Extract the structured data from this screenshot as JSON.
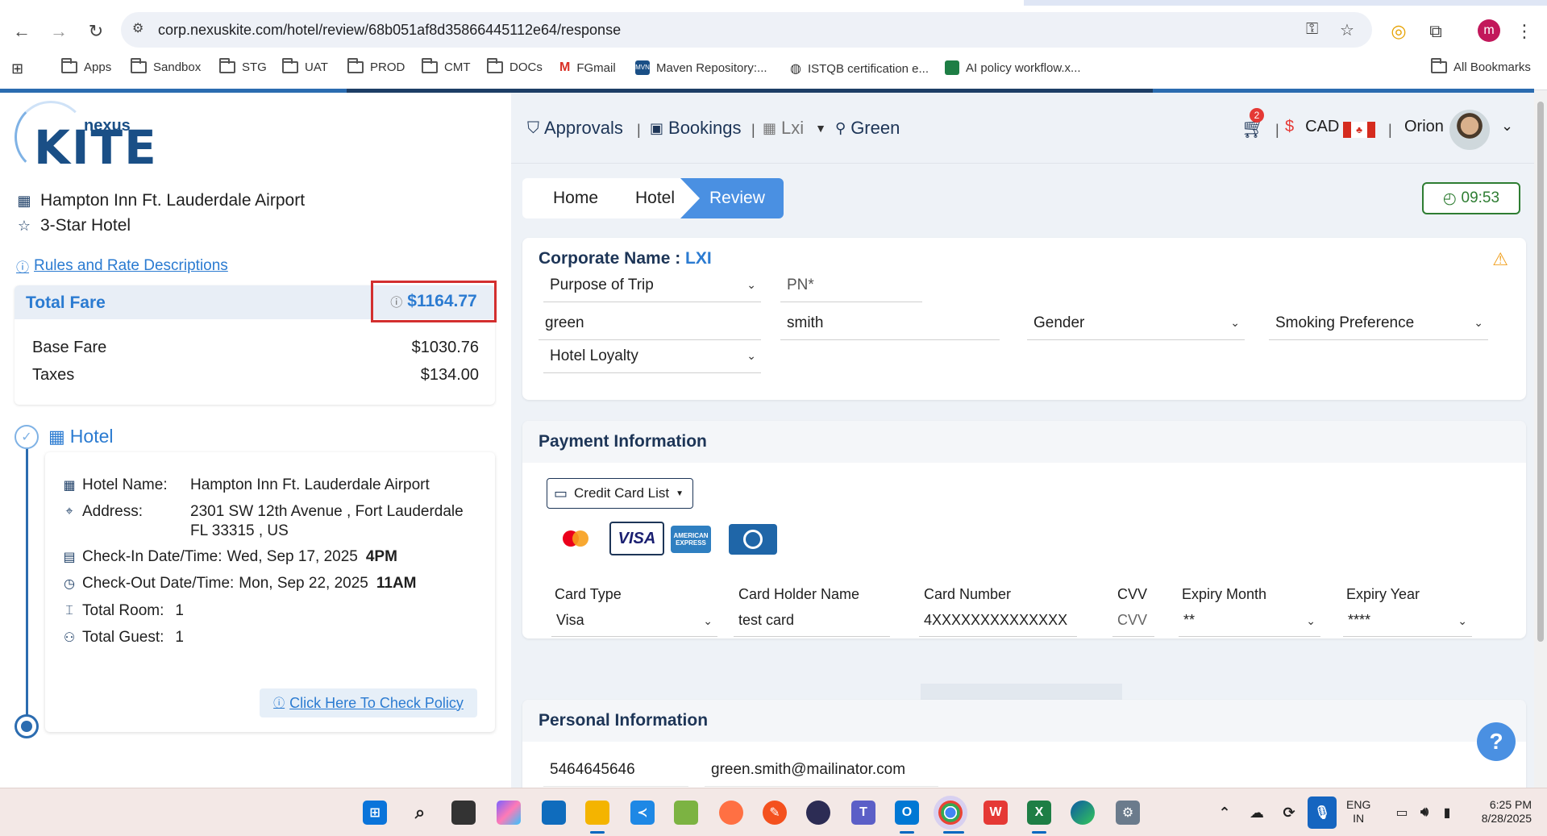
{
  "browser": {
    "url": "corp.nexuskite.com/hotel/review/68b051af8d35866445112e64/response",
    "profile_initial": "m",
    "bookmarks": [
      {
        "label": "Apps"
      },
      {
        "label": "Sandbox"
      },
      {
        "label": "STG"
      },
      {
        "label": "UAT"
      },
      {
        "label": "PROD"
      },
      {
        "label": "CMT"
      },
      {
        "label": "DOCs"
      },
      {
        "label": "FGmail"
      },
      {
        "label": "Maven Repository:..."
      },
      {
        "label": "ISTQB certification e..."
      },
      {
        "label": "AI policy workflow.x..."
      }
    ],
    "all_bookmarks": "All Bookmarks"
  },
  "logo": {
    "nexus": "nexus",
    "kite": "KITE"
  },
  "hotel_summary": {
    "name": "Hampton Inn Ft. Lauderdale Airport",
    "rating": "3-Star Hotel",
    "rules_link": "Rules and Rate Descriptions"
  },
  "fare": {
    "title": "Total Fare",
    "total": "$1164.77",
    "base_label": "Base Fare",
    "base_value": "$1030.76",
    "taxes_label": "Taxes",
    "taxes_value": "$134.00"
  },
  "hotel_details": {
    "section_title": "Hotel",
    "name_label": "Hotel Name:",
    "name_value": "Hampton Inn Ft. Lauderdale Airport",
    "address_label": "Address:",
    "address_line1": "2301 SW 12th Avenue , Fort Lauderdale",
    "address_line2": "FL 33315 , US",
    "checkin_label": "Check-In Date/Time:",
    "checkin_date": "Wed, Sep 17, 2025",
    "checkin_time": "4PM",
    "checkout_label": "Check-Out Date/Time:",
    "checkout_date": "Mon, Sep 22, 2025",
    "checkout_time": "11AM",
    "rooms_label": "Total Room:",
    "rooms_value": "1",
    "guests_label": "Total Guest:",
    "guests_value": "1",
    "policy_link": "Click Here To Check Policy"
  },
  "header": {
    "approvals": "Approvals",
    "bookings": "Bookings",
    "company": "Lxi",
    "user_short": "Green",
    "cart_count": "2",
    "currency_symbol": "$",
    "currency": "CAD",
    "user_name": "Orion"
  },
  "breadcrumb": {
    "home": "Home",
    "hotel": "Hotel",
    "review": "Review"
  },
  "timer": "09:53",
  "corporate": {
    "title_label": "Corporate Name :",
    "title_value": "LXI",
    "purpose_of_trip": "Purpose of Trip",
    "pn_placeholder": "PN*",
    "first_name": "green",
    "last_name": "smith",
    "gender": "Gender",
    "smoking": "Smoking Preference",
    "hotel_loyalty": "Hotel Loyalty"
  },
  "payment": {
    "title": "Payment Information",
    "cc_list": "Credit Card List",
    "card_type_label": "Card Type",
    "card_type_value": "Visa",
    "holder_label": "Card Holder Name",
    "holder_value": "test card",
    "number_label": "Card Number",
    "number_value": "4XXXXXXXXXXXXXX",
    "cvv_label": "CVV",
    "cvv_placeholder": "CVV",
    "exp_month_label": "Expiry Month",
    "exp_month_value": "**",
    "exp_year_label": "Expiry Year",
    "exp_year_value": "****",
    "brands": {
      "visa": "VISA",
      "amex": "AMERICAN EXPRESS"
    }
  },
  "personal": {
    "title": "Personal Information",
    "phone": "5464645646",
    "email": "green.smith@mailinator.com"
  },
  "help_label": "?",
  "taskbar": {
    "lang": "ENG",
    "region": "IN",
    "time": "6:25 PM",
    "date": "8/28/2025"
  }
}
